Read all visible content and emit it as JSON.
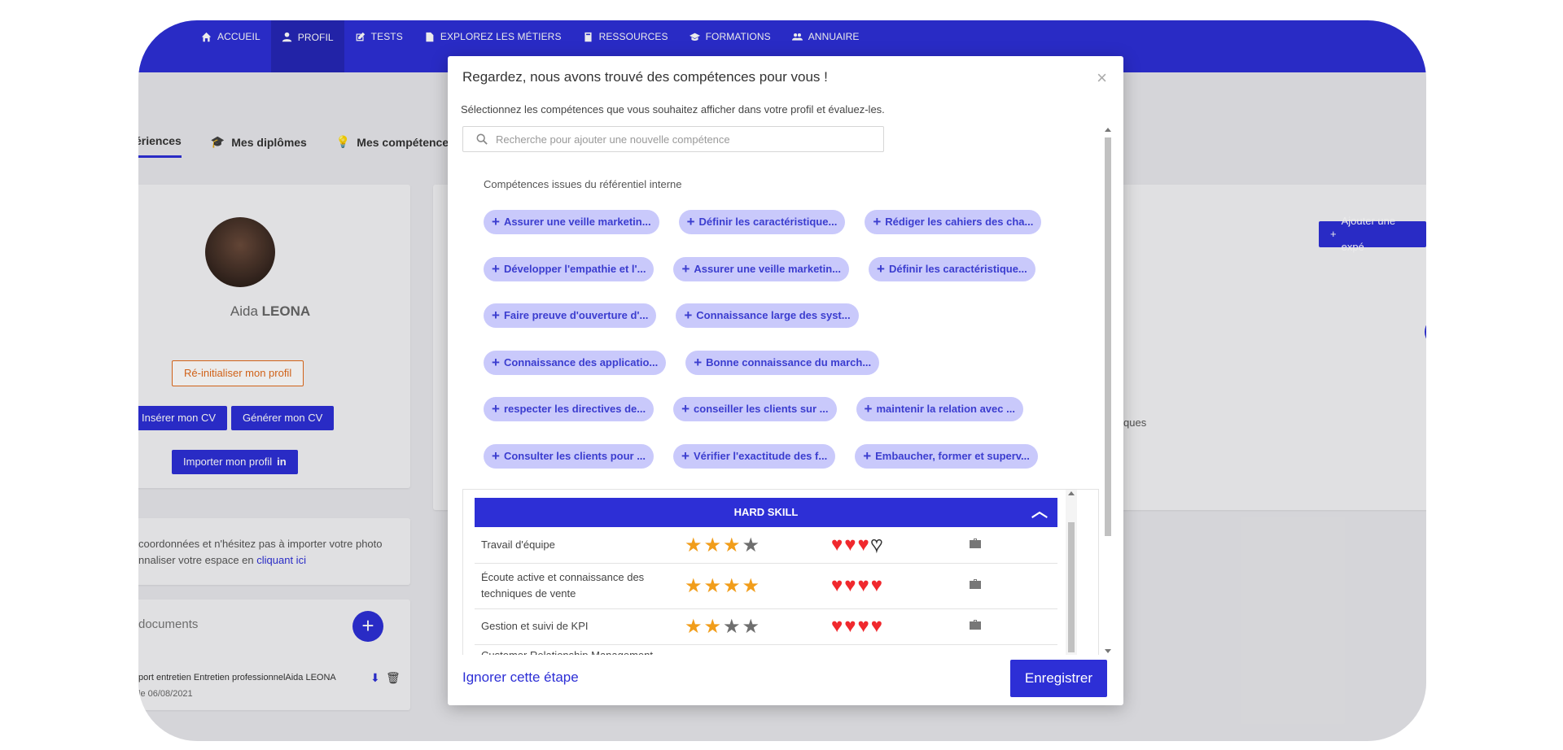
{
  "nav": {
    "items": [
      {
        "label": "ACCUEIL",
        "icon": "home-icon"
      },
      {
        "label": "PROFIL",
        "icon": "user-icon"
      },
      {
        "label": "TESTS",
        "icon": "edit-icon"
      },
      {
        "label": "EXPLOREZ LES MÉTIERS",
        "icon": "document-icon"
      },
      {
        "label": "RESSOURCES",
        "icon": "book-icon"
      },
      {
        "label": "FORMATIONS",
        "icon": "graduation-cap-icon"
      },
      {
        "label": "ANNUAIRE",
        "icon": "users-icon"
      }
    ]
  },
  "background": {
    "tabs": [
      "ériences",
      "Mes diplômes",
      "Mes compétences"
    ],
    "profile": {
      "name_first": "Aida ",
      "name_last": "LEONA",
      "reset_label": "Ré-initialiser mon profil",
      "insert_cv": "Insérer mon CV",
      "generate_cv": "Générer mon CV",
      "import_profile": "Importer mon profil"
    },
    "add_experience": "Ajouter une expé",
    "partial_text": "ques",
    "info_line1": " coordonnées et n'hésitez pas à importer votre photo",
    "info_line2": "nnaliser votre espace en ",
    "info_link": "cliquant ici",
    "documents_title": "documents",
    "doc_name": "port entretien Entretien professionnelAida LEONA",
    "doc_date": "le 06/08/2021"
  },
  "modal": {
    "title": "Regardez, nous avons trouvé des compétences pour vous !",
    "subtitle": "Sélectionnez les compétences que vous souhaitez afficher dans votre profil et évaluez-les.",
    "search_placeholder": "Recherche pour ajouter une nouvelle compétence",
    "ref_label": "Compétences issues du référentiel interne",
    "chips": [
      [
        "Assurer une veille marketin...",
        "Définir les caractéristique...",
        "Rédiger les cahiers des cha..."
      ],
      [
        "Développer l'empathie et l'...",
        "Assurer une veille marketin...",
        "Définir les caractéristique..."
      ],
      [
        "Faire preuve d'ouverture d'...",
        "Connaissance large des syst..."
      ],
      [
        "Connaissance des applicatio...",
        "Bonne connaissance du march..."
      ],
      [
        "respecter les directives de...",
        "conseiller les clients sur ...",
        "maintenir la relation avec ..."
      ],
      [
        "Consulter les clients pour ...",
        "Vérifier l'exactitude des f...",
        "Embaucher, former et superv..."
      ]
    ],
    "hard_skill_header": "HARD SKILL",
    "skills": [
      {
        "name": "Travail d'équipe",
        "stars": 3,
        "hearts": 3
      },
      {
        "name": "Écoute active et connaissance des techniques de vente",
        "stars": 4,
        "hearts": 4
      },
      {
        "name": "Gestion et suivi de KPI",
        "stars": 2,
        "hearts": 4
      },
      {
        "name": "Customer Relationship Management",
        "stars": 0,
        "hearts": 0
      }
    ],
    "ignore_label": "Ignorer cette étape",
    "save_label": "Enregistrer",
    "close_symbol": "×"
  },
  "colors": {
    "brand": "#2d2fd6",
    "chip": "#c9c9fb",
    "star": "#f19d1a",
    "heart": "#f0282d"
  }
}
